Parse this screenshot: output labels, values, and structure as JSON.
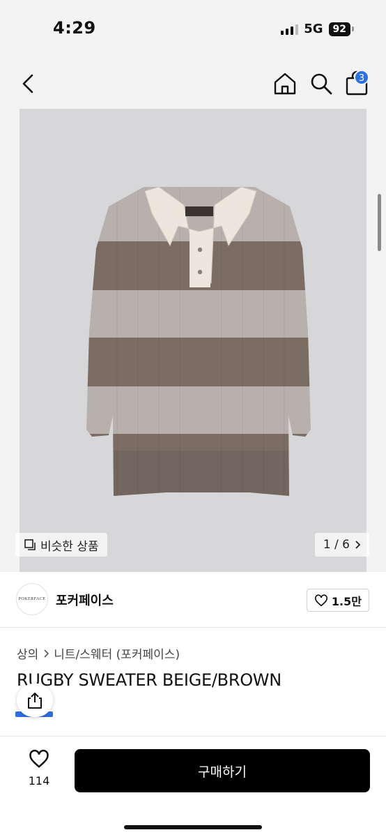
{
  "status": {
    "time": "4:29",
    "network": "5G",
    "battery": "92"
  },
  "nav": {
    "cart_count": "3"
  },
  "image": {
    "similar_label": "비슷한 상품",
    "page": "1 / 6"
  },
  "shop": {
    "logo_text": "POKERFACE",
    "name": "포커페이스",
    "likes": "1.5만"
  },
  "breadcrumb": {
    "category": "상의",
    "subcategory": "니트/스웨터 (포커페이스)"
  },
  "product": {
    "title": "RUGBY SWEATER BEIGE/BROWN"
  },
  "bottom": {
    "wish_count": "114",
    "buy_label": "구매하기"
  },
  "colors": {
    "accent": "#2f6fe0",
    "stripe_light": "#b8b0ad",
    "stripe_dark": "#7b6d64",
    "collar": "#ece7dc"
  }
}
